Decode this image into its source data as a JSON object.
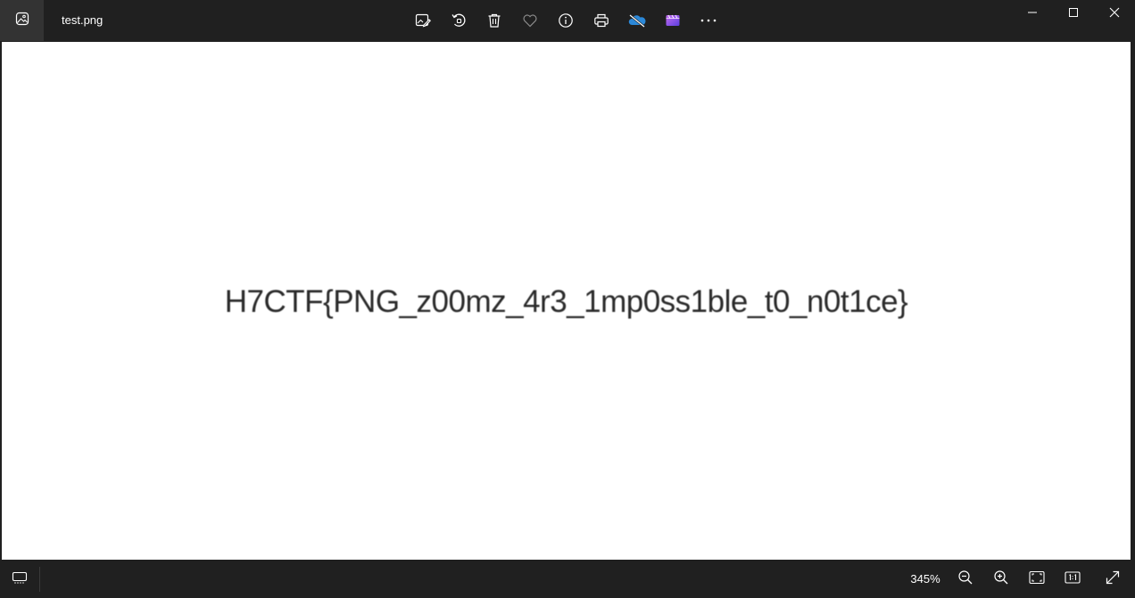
{
  "titlebar": {
    "filename": "test.png",
    "app_icon": "photos-app-icon"
  },
  "toolbar": {
    "items": [
      {
        "name": "edit-image-icon"
      },
      {
        "name": "rotate-icon"
      },
      {
        "name": "delete-icon"
      },
      {
        "name": "favorite-icon"
      },
      {
        "name": "info-icon"
      },
      {
        "name": "print-icon"
      },
      {
        "name": "onedrive-icon"
      },
      {
        "name": "clipchamp-icon"
      },
      {
        "name": "more-icon"
      }
    ]
  },
  "window_controls": {
    "minimize": "minimize-icon",
    "maximize": "maximize-icon",
    "close": "close-icon"
  },
  "image": {
    "text": "H7CTF{PNG_z00mz_4r3_1mp0ss1ble_t0_n0t1ce}"
  },
  "bottombar": {
    "zoom_level": "345%",
    "items": [
      {
        "name": "filmstrip-icon"
      },
      {
        "name": "zoom-out-icon"
      },
      {
        "name": "zoom-in-icon"
      },
      {
        "name": "fit-to-window-icon"
      },
      {
        "name": "actual-size-icon"
      },
      {
        "name": "full-screen-icon"
      }
    ]
  },
  "colors": {
    "chrome_bg": "#202020",
    "app_button_bg": "#333333",
    "icon_color": "#ffffff",
    "canvas_bg": "#ffffff",
    "onedrive_blue": "#2b88d8",
    "clipchamp_purple": "#8a5cf6"
  }
}
